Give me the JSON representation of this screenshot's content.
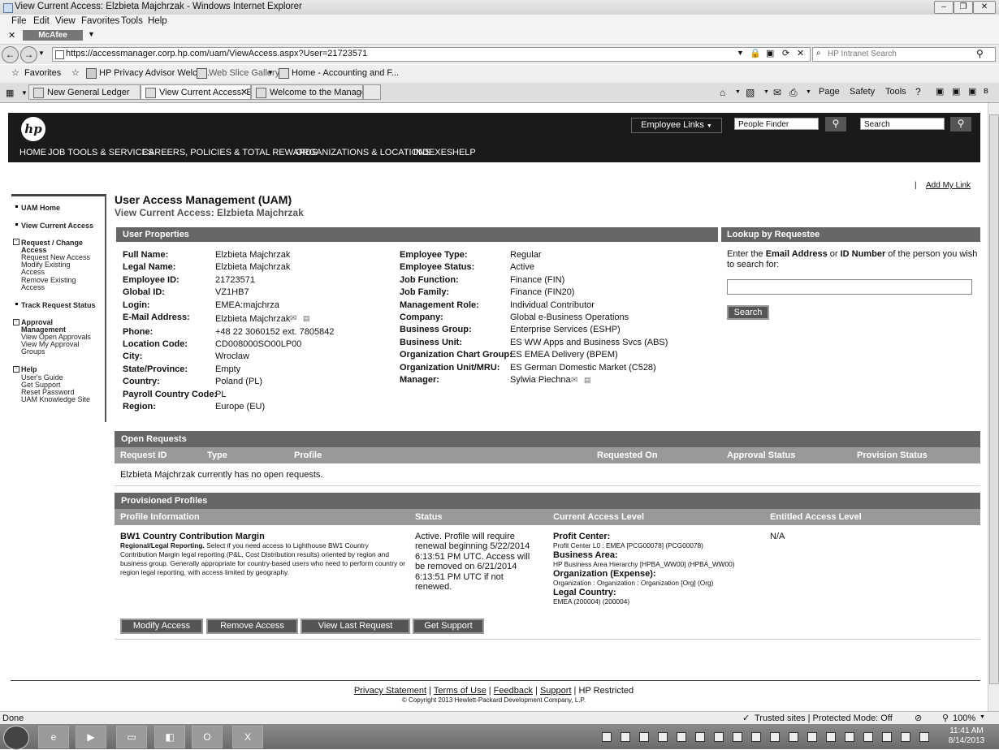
{
  "window": {
    "title": "View Current Access: Elzbieta Majchrzak - Windows Internet Explorer"
  },
  "menu": [
    "File",
    "Edit",
    "View",
    "Favorites",
    "Tools",
    "Help"
  ],
  "mcafee": "McAfee",
  "address": {
    "url": "https://accessmanager.corp.hp.com/uam/ViewAccess.aspx?User=21723571",
    "search_placeholder": "HP Intranet Search"
  },
  "favorites": {
    "label": "Favorites",
    "items": [
      "HP Privacy Advisor Welco...",
      "Web Slice Gallery",
      "Home - Accounting and F..."
    ]
  },
  "tabs": [
    "New General Ledger",
    "View Current Access: El...",
    "Welcome to the Manager'..."
  ],
  "commandbar": {
    "page": "Page",
    "safety": "Safety",
    "tools": "Tools"
  },
  "hp": {
    "logo": "hp",
    "employee_links": "Employee Links",
    "people_finder": "People Finder",
    "search": "Search",
    "nav": [
      "HOME",
      "JOB TOOLS & SERVICES",
      "CAREERS, POLICIES & TOTAL REWARDS",
      "ORGANIZATIONS & LOCATIONS",
      "INDEXES",
      "HELP"
    ]
  },
  "add_my_link": "Add My Link",
  "leftnav": {
    "uam_home": "UAM Home",
    "view_current": "View Current Access",
    "request_change": "Request / Change",
    "access": "Access",
    "request_new": "Request New Access",
    "modify_existing": "Modify Existing",
    "modify_access": "Access",
    "remove_existing": "Remove Existing",
    "remove_access": "Access",
    "track": "Track Request Status",
    "approval": "Approval",
    "management": "Management",
    "view_open": "View Open Approvals",
    "view_my": "View My Approval",
    "groups": "Groups",
    "help": "Help",
    "users_guide": "User's Guide",
    "get_support": "Get Support",
    "reset_password": "Reset Password",
    "knowledge": "UAM Knowledge Site"
  },
  "page": {
    "title": "User Access Management (UAM)",
    "subtitle": "View Current Access: Elzbieta Majchrzak"
  },
  "user_properties": {
    "header": "User Properties",
    "left": [
      {
        "label": "Full Name:",
        "value": "Elzbieta Majchrzak"
      },
      {
        "label": "Legal Name:",
        "value": "Elzbieta Majchrzak"
      },
      {
        "label": "Employee ID:",
        "value": "21723571"
      },
      {
        "label": "Global ID:",
        "value": "VZ1HB7"
      },
      {
        "label": "Login:",
        "value": "EMEA:majchrza"
      },
      {
        "label": "E-Mail Address:",
        "value": "Elzbieta Majchrzak"
      },
      {
        "label": "Phone:",
        "value": "+48 22 3060152 ext. 7805842"
      },
      {
        "label": "Location Code:",
        "value": "CD008000SO00LP00"
      },
      {
        "label": "City:",
        "value": "Wroclaw"
      },
      {
        "label": "State/Province:",
        "value": "Empty"
      },
      {
        "label": "Country:",
        "value": "Poland (PL)"
      },
      {
        "label": "Payroll Country Code:",
        "value": "PL"
      },
      {
        "label": "Region:",
        "value": "Europe (EU)"
      }
    ],
    "right": [
      {
        "label": "Employee Type:",
        "value": "Regular"
      },
      {
        "label": "Employee Status:",
        "value": "Active"
      },
      {
        "label": "Job Function:",
        "value": "Finance (FIN)"
      },
      {
        "label": "Job Family:",
        "value": "Finance (FIN20)"
      },
      {
        "label": "Management Role:",
        "value": "Individual Contributor"
      },
      {
        "label": "Company:",
        "value": "Global e-Business Operations"
      },
      {
        "label": "Business Group:",
        "value": "Enterprise Services (ESHP)"
      },
      {
        "label": "Business Unit:",
        "value": "ES WW Apps and Business Svcs (ABS)"
      },
      {
        "label": "Organization Chart Group:",
        "value": "ES EMEA Delivery (BPEM)"
      },
      {
        "label": "Organization Unit/MRU:",
        "value": "ES German Domestic Market (C528)"
      },
      {
        "label": "Manager:",
        "value": "Sylwia Piechna"
      }
    ]
  },
  "lookup": {
    "header": "Lookup by Requestee",
    "text_pre": "Enter the ",
    "email": "Email Address",
    "or": " or ",
    "id": "ID Number",
    "text_post": " of the person you wish to search for:",
    "button": "Search"
  },
  "open_requests": {
    "header": "Open Requests",
    "columns": [
      "Request ID",
      "Type",
      "Profile",
      "Requested On",
      "Approval Status",
      "Provision Status"
    ],
    "empty": "Elzbieta Majchrzak currently has no open requests."
  },
  "provisioned": {
    "header": "Provisioned Profiles",
    "columns": [
      "Profile Information",
      "Status",
      "Current Access Level",
      "Entitled Access Level"
    ],
    "profile_name": "BW1 Country Contribution Margin",
    "profile_desc_bold": "Regional/Legal Reporting.",
    "profile_desc": " Select if you need access to Lighthouse BW1 Country Contribution Margin legal reporting (P&L, Cost Distribution results) oriented by region and business group. Generally appropriate for country-based users who need to perform country or region legal reporting, with access limited by geography.",
    "status": "Active. Profile will require renewal beginning 5/22/2014 6:13:51 PM UTC. Access will be removed on 6/21/2014 6:13:51 PM UTC if not renewed.",
    "access": [
      {
        "label": "Profit Center:",
        "value": "Profit Center L0 : EMEA [PCG00078] (PCG00078)"
      },
      {
        "label": "Business Area:",
        "value": "HP Business Area Hierarchy [HPBA_WW00] (HPBA_WW00)"
      },
      {
        "label": "Organization (Expense):",
        "value": "Organization : Organization : Organization [Org] (Org)"
      },
      {
        "label": "Legal Country:",
        "value": "EMEA (200004) (200004)"
      }
    ],
    "entitled": "N/A"
  },
  "buttons": {
    "modify": "Modify Access",
    "remove": "Remove Access",
    "view_last": "View Last Request",
    "get_support": "Get Support"
  },
  "footer": {
    "privacy": "Privacy Statement",
    "terms": "Terms of Use",
    "feedback": "Feedback",
    "support": "Support",
    "restricted": "HP Restricted",
    "copyright": "© Copyright 2013 Hewlett-Packard Development Company, L.P."
  },
  "status": {
    "left": "Done",
    "zone": "Trusted sites | Protected Mode: Off",
    "zoom": "100%"
  },
  "clock": {
    "time": "11:41 AM",
    "date": "8/14/2013"
  }
}
